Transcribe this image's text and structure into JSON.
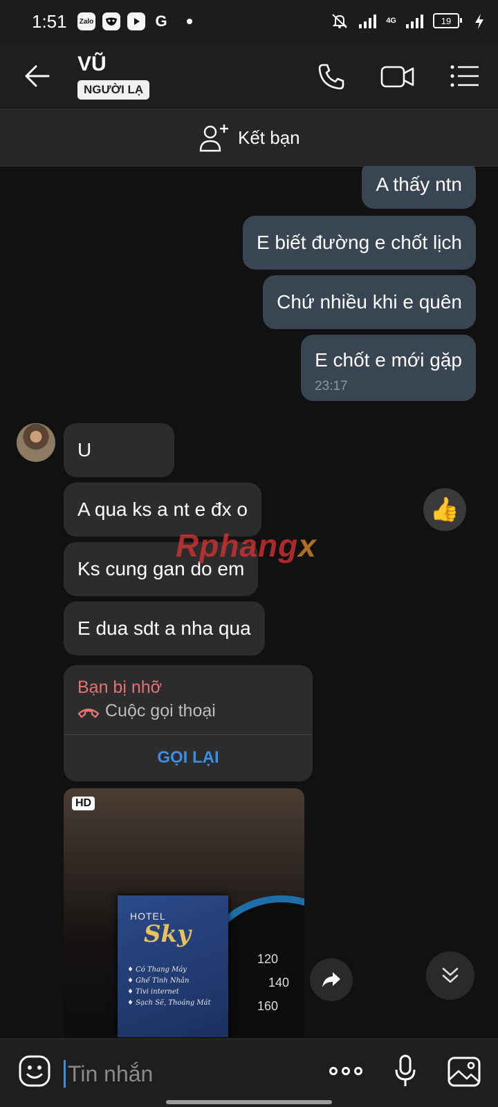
{
  "status_bar": {
    "time": "1:51",
    "apps": [
      {
        "name": "zalo-icon",
        "label": "Zalo"
      },
      {
        "name": "mask-app-icon",
        "label": ""
      },
      {
        "name": "youtube-icon",
        "label": ""
      },
      {
        "name": "google-icon",
        "label": ""
      }
    ],
    "network": "4G",
    "battery": "19"
  },
  "header": {
    "name": "VŨ",
    "tag": "NGƯỜI LẠ",
    "icons": [
      "back-arrow-icon",
      "phone-icon",
      "video-icon",
      "list-menu-icon"
    ]
  },
  "friend_bar": {
    "label": "Kết bạn",
    "icon": "add-friend-icon"
  },
  "messages_out": [
    {
      "text": "A thấy ntn"
    },
    {
      "text": "E biết đường e chốt lịch"
    },
    {
      "text": "Chứ nhiều khi e quên"
    },
    {
      "text": "E chốt e mới gặp",
      "time": "23:17"
    }
  ],
  "messages_in": [
    {
      "text": "U"
    },
    {
      "text": "A qua ks a nt e đx o"
    },
    {
      "text": "Ks cung gan do em"
    },
    {
      "text": "E dua sdt a nha qua"
    }
  ],
  "missed_call": {
    "title": "Bạn bị nhỡ",
    "subtitle": "Cuộc gọi thoại",
    "action": "GỌI LẠI",
    "color": "#e57373"
  },
  "photo": {
    "badge": "HD",
    "card_hotel": "HOTEL",
    "card_brand": "Sky",
    "card_lines": [
      "Có Thang Máy",
      "Ghế Tình Nhân",
      "Tivi internet",
      "Sạch Sẽ, Thoáng Mát"
    ],
    "gauge_numbers": [
      "120",
      "140",
      "160"
    ]
  },
  "watermark": {
    "text": "Rphang",
    "suffix": "x"
  },
  "composer": {
    "placeholder": "Tin nhắn",
    "icons": [
      "emoji-icon",
      "more-dots-icon",
      "mic-icon",
      "image-icon"
    ]
  },
  "colors": {
    "background": "#111111",
    "bubble_out": "#3a4553",
    "bubble_in": "#2c2c2c",
    "accent": "#3d8fe3"
  }
}
